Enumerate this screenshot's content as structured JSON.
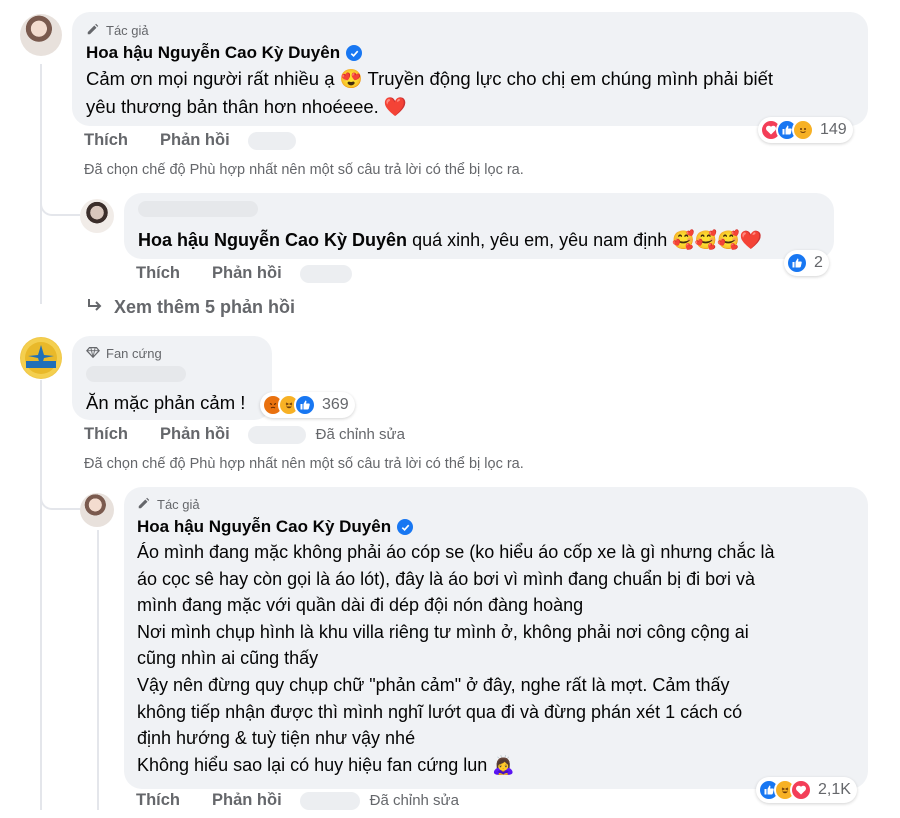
{
  "comments": [
    {
      "badge": "Tác giả",
      "author": "Hoa hậu Nguyễn Cao Kỳ Duyên",
      "text_line1": "Cảm ơn mọi người rất nhiều ạ 😍 Truyền động lực cho chị em chúng mình phải biết",
      "text_line2": "yêu thương bản thân hơn nhoéeee. ❤️",
      "like_label": "Thích",
      "reply_label": "Phản hồi",
      "reaction_count": "149",
      "filter_note": "Đã chọn chế độ Phù hợp nhất nên một số câu trả lời có thể bị lọc ra."
    },
    {
      "mention": "Hoa hậu Nguyễn Cao Kỳ Duyên",
      "text": "quá xinh, yêu em, yêu nam định 🥰🥰🥰❤️",
      "like_label": "Thích",
      "reply_label": "Phản hồi",
      "reaction_count": "2"
    },
    {
      "more_replies": "Xem thêm 5 phản hồi"
    },
    {
      "badge": "Fan cứng",
      "text": "Ăn mặc phản cảm !",
      "like_label": "Thích",
      "reply_label": "Phản hồi",
      "edited_label": "Đã chỉnh sửa",
      "reaction_count": "369",
      "filter_note": "Đã chọn chế độ Phù hợp nhất nên một số câu trả lời có thể bị lọc ra."
    },
    {
      "badge": "Tác giả",
      "author": "Hoa hậu Nguyễn Cao Kỳ Duyên",
      "lines": [
        "Áo mình đang mặc không phải áo cóp se (ko hiểu áo cốp xe là gì nhưng chắc là",
        "áo cọc sê hay còn gọi là áo lót), đây là áo bơi vì mình đang chuẩn bị đi bơi và",
        "mình đang mặc với quần dài đi dép đội nón đàng hoàng",
        "Nơi mình chụp hình là khu villa riêng tư mình ở, không phải nơi công cộng ai",
        "cũng nhìn ai cũng thấy",
        "Vậy nên đừng quy chụp chữ \"phản cảm\" ở đây, nghe rất là mợt. Cảm thấy",
        "không tiếp nhận được thì mình nghĩ lướt qua đi và đừng phán xét 1 cách có",
        "định hướng & tuỳ tiện như vậy nhé",
        "Không hiểu sao lại có huy hiệu fan cứng lun 🙇‍♀️"
      ],
      "like_label": "Thích",
      "reply_label": "Phản hồi",
      "edited_label": "Đã chỉnh sửa",
      "reaction_count": "2,1K"
    }
  ],
  "colors": {
    "bubble": "#f0f2f5",
    "secondary_text": "#65676b",
    "like_blue": "#1877f2",
    "love_red": "#f33e58",
    "haha_yellow": "#f7b125"
  },
  "icons": [
    "pencil-icon",
    "verified-icon",
    "diamond-icon",
    "reply-arrow-icon",
    "like-reaction-icon",
    "love-reaction-icon",
    "haha-reaction-icon",
    "angry-reaction-icon"
  ]
}
